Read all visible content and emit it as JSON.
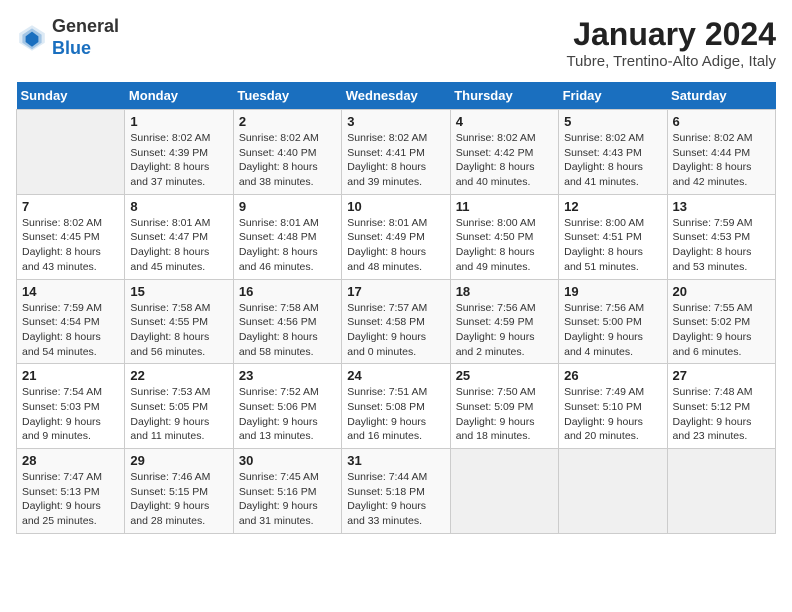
{
  "header": {
    "logo_line1": "General",
    "logo_line2": "Blue",
    "month": "January 2024",
    "location": "Tubre, Trentino-Alto Adige, Italy"
  },
  "weekdays": [
    "Sunday",
    "Monday",
    "Tuesday",
    "Wednesday",
    "Thursday",
    "Friday",
    "Saturday"
  ],
  "weeks": [
    [
      {
        "day": "",
        "sunrise": "",
        "sunset": "",
        "daylight": ""
      },
      {
        "day": "1",
        "sunrise": "8:02 AM",
        "sunset": "4:39 PM",
        "daylight": "8 hours and 37 minutes."
      },
      {
        "day": "2",
        "sunrise": "8:02 AM",
        "sunset": "4:40 PM",
        "daylight": "8 hours and 38 minutes."
      },
      {
        "day": "3",
        "sunrise": "8:02 AM",
        "sunset": "4:41 PM",
        "daylight": "8 hours and 39 minutes."
      },
      {
        "day": "4",
        "sunrise": "8:02 AM",
        "sunset": "4:42 PM",
        "daylight": "8 hours and 40 minutes."
      },
      {
        "day": "5",
        "sunrise": "8:02 AM",
        "sunset": "4:43 PM",
        "daylight": "8 hours and 41 minutes."
      },
      {
        "day": "6",
        "sunrise": "8:02 AM",
        "sunset": "4:44 PM",
        "daylight": "8 hours and 42 minutes."
      }
    ],
    [
      {
        "day": "7",
        "sunrise": "8:02 AM",
        "sunset": "4:45 PM",
        "daylight": "8 hours and 43 minutes."
      },
      {
        "day": "8",
        "sunrise": "8:01 AM",
        "sunset": "4:47 PM",
        "daylight": "8 hours and 45 minutes."
      },
      {
        "day": "9",
        "sunrise": "8:01 AM",
        "sunset": "4:48 PM",
        "daylight": "8 hours and 46 minutes."
      },
      {
        "day": "10",
        "sunrise": "8:01 AM",
        "sunset": "4:49 PM",
        "daylight": "8 hours and 48 minutes."
      },
      {
        "day": "11",
        "sunrise": "8:00 AM",
        "sunset": "4:50 PM",
        "daylight": "8 hours and 49 minutes."
      },
      {
        "day": "12",
        "sunrise": "8:00 AM",
        "sunset": "4:51 PM",
        "daylight": "8 hours and 51 minutes."
      },
      {
        "day": "13",
        "sunrise": "7:59 AM",
        "sunset": "4:53 PM",
        "daylight": "8 hours and 53 minutes."
      }
    ],
    [
      {
        "day": "14",
        "sunrise": "7:59 AM",
        "sunset": "4:54 PM",
        "daylight": "8 hours and 54 minutes."
      },
      {
        "day": "15",
        "sunrise": "7:58 AM",
        "sunset": "4:55 PM",
        "daylight": "8 hours and 56 minutes."
      },
      {
        "day": "16",
        "sunrise": "7:58 AM",
        "sunset": "4:56 PM",
        "daylight": "8 hours and 58 minutes."
      },
      {
        "day": "17",
        "sunrise": "7:57 AM",
        "sunset": "4:58 PM",
        "daylight": "9 hours and 0 minutes."
      },
      {
        "day": "18",
        "sunrise": "7:56 AM",
        "sunset": "4:59 PM",
        "daylight": "9 hours and 2 minutes."
      },
      {
        "day": "19",
        "sunrise": "7:56 AM",
        "sunset": "5:00 PM",
        "daylight": "9 hours and 4 minutes."
      },
      {
        "day": "20",
        "sunrise": "7:55 AM",
        "sunset": "5:02 PM",
        "daylight": "9 hours and 6 minutes."
      }
    ],
    [
      {
        "day": "21",
        "sunrise": "7:54 AM",
        "sunset": "5:03 PM",
        "daylight": "9 hours and 9 minutes."
      },
      {
        "day": "22",
        "sunrise": "7:53 AM",
        "sunset": "5:05 PM",
        "daylight": "9 hours and 11 minutes."
      },
      {
        "day": "23",
        "sunrise": "7:52 AM",
        "sunset": "5:06 PM",
        "daylight": "9 hours and 13 minutes."
      },
      {
        "day": "24",
        "sunrise": "7:51 AM",
        "sunset": "5:08 PM",
        "daylight": "9 hours and 16 minutes."
      },
      {
        "day": "25",
        "sunrise": "7:50 AM",
        "sunset": "5:09 PM",
        "daylight": "9 hours and 18 minutes."
      },
      {
        "day": "26",
        "sunrise": "7:49 AM",
        "sunset": "5:10 PM",
        "daylight": "9 hours and 20 minutes."
      },
      {
        "day": "27",
        "sunrise": "7:48 AM",
        "sunset": "5:12 PM",
        "daylight": "9 hours and 23 minutes."
      }
    ],
    [
      {
        "day": "28",
        "sunrise": "7:47 AM",
        "sunset": "5:13 PM",
        "daylight": "9 hours and 25 minutes."
      },
      {
        "day": "29",
        "sunrise": "7:46 AM",
        "sunset": "5:15 PM",
        "daylight": "9 hours and 28 minutes."
      },
      {
        "day": "30",
        "sunrise": "7:45 AM",
        "sunset": "5:16 PM",
        "daylight": "9 hours and 31 minutes."
      },
      {
        "day": "31",
        "sunrise": "7:44 AM",
        "sunset": "5:18 PM",
        "daylight": "9 hours and 33 minutes."
      },
      {
        "day": "",
        "sunrise": "",
        "sunset": "",
        "daylight": ""
      },
      {
        "day": "",
        "sunrise": "",
        "sunset": "",
        "daylight": ""
      },
      {
        "day": "",
        "sunrise": "",
        "sunset": "",
        "daylight": ""
      }
    ]
  ]
}
